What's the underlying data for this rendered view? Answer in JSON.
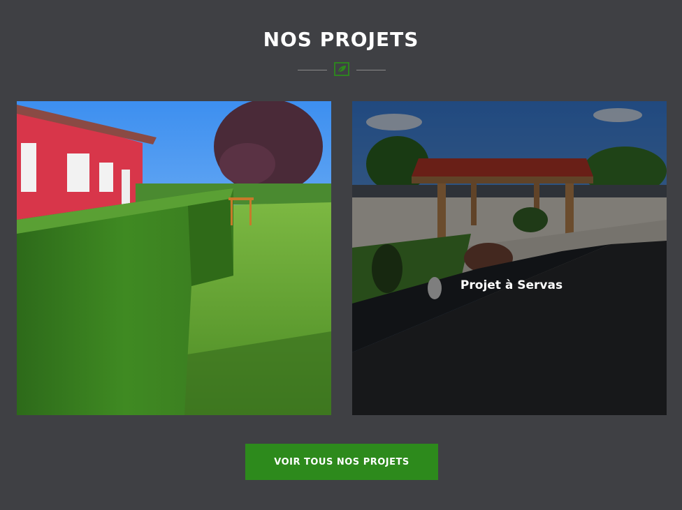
{
  "section": {
    "title": "NOS PROJETS",
    "divider_icon": "leaf-box-icon",
    "accent_color": "#2d8a1c"
  },
  "projects": [
    {
      "caption": "",
      "image": "hedge-and-lawn-photo"
    },
    {
      "caption": "Projet à Servas",
      "image": "carport-and-driveway-photo"
    }
  ],
  "cta": {
    "label": "VOIR TOUS NOS PROJETS"
  }
}
